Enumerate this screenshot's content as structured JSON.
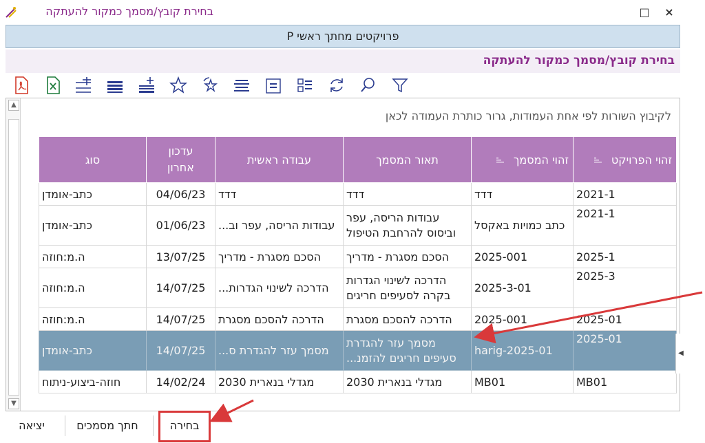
{
  "window": {
    "title": "בחירת קובץ/מסמך כמקור להעתקה",
    "maximize_icon": "□",
    "close_icon": "×"
  },
  "header": {
    "project_bar": "פרויקטים מחתך ראשי P"
  },
  "subtitle": "בחירת קובץ/מסמך כמקור להעתקה",
  "toolbar": {
    "icons": [
      "pdf-icon",
      "excel-icon",
      "add-row-icon",
      "lines-icon",
      "insert-lines-icon",
      "star-icon",
      "star-refresh-icon",
      "align-icon",
      "center-icon",
      "list-icon",
      "refresh-icon",
      "search-icon",
      "filter-icon"
    ]
  },
  "grid": {
    "group_hint": "לקיבוץ השורות לפי אחת העמודות, גרור כותרת העמודה לכאן",
    "columns": [
      "זהוי הפרויקט",
      "זהוי המסמך",
      "תאור המסמך",
      "עבודה ראשית",
      "עדכון אחרון",
      "סוג"
    ],
    "rows": [
      {
        "project": "2021-1",
        "doc_id": "דדד",
        "desc": "דדד",
        "main_work": "דדד",
        "updated": "04/06/23",
        "type": "כתב-אומדן"
      },
      {
        "project": "2021-1",
        "doc_id": "כתב כמויות באקסל",
        "desc": "עבודות הריסה, עפר וביסוס להרחבת הטיפול",
        "main_work": "עבודות הריסה, עפר וב...",
        "updated": "01/06/23",
        "type": "כתב-אומדן"
      },
      {
        "project": "2025-1",
        "doc_id": "2025-001",
        "desc": "הסכם מסגרת - מדריך",
        "main_work": "הסכם מסגרת - מדריך",
        "updated": "13/07/25",
        "type": "ה.מ:חוזה"
      },
      {
        "project": "2025-3",
        "doc_id": "2025-3-01",
        "desc": "הדרכה לשינוי הגדרות בקרה לסעיפים חריגים",
        "main_work": "הדרכה לשינוי הגדרות...",
        "updated": "14/07/25",
        "type": "ה.מ:חוזה"
      },
      {
        "project": "2025-01",
        "doc_id": "2025-001",
        "desc": "הדרכה להסכם מסגרת",
        "main_work": "הדרכה להסכם מסגרת",
        "updated": "14/07/25",
        "type": "ה.מ:חוזה"
      },
      {
        "project": "2025-01",
        "doc_id": "harig-2025-01",
        "desc": "מסמך עזר להגדרת סעיפים חריגים להזמנ...",
        "main_work": "מסמך עזר להגדרת ס...",
        "updated": "14/07/25",
        "type": "כתב-אומדן"
      },
      {
        "project": "MB01",
        "doc_id": "MB01",
        "desc": "מגדלי בנארית 2030",
        "main_work": "מגדלי בנארית 2030",
        "updated": "14/02/24",
        "type": "חוזה-ביצוע-ניתוח"
      }
    ]
  },
  "bottom": {
    "select_label": "בחירה",
    "cut_docs_label": "חתך מסמכים",
    "exit_label": "יציאה"
  },
  "colors": {
    "header_bg": "#b17cbb",
    "selected_row": "#7a9db5",
    "title_purple": "#8a2a8a",
    "annotation_red": "#d9393a"
  }
}
